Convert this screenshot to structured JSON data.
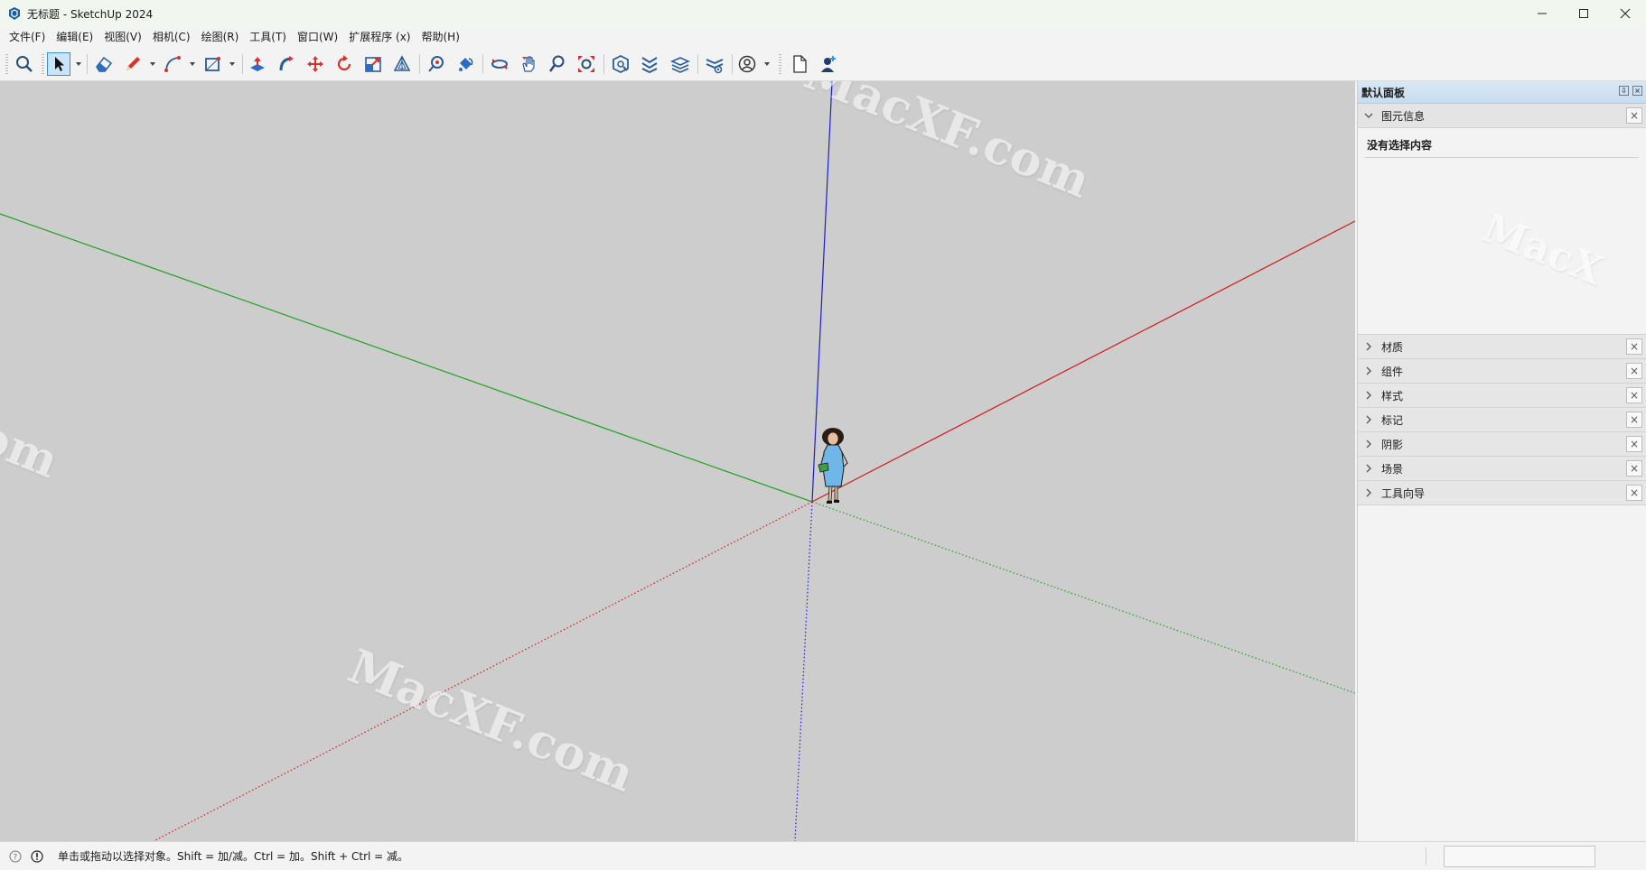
{
  "window": {
    "title": "无标题 - SketchUp 2024"
  },
  "menu": [
    "文件(F)",
    "编辑(E)",
    "视图(V)",
    "相机(C)",
    "绘图(R)",
    "工具(T)",
    "窗口(W)",
    "扩展程序 (x)",
    "帮助(H)"
  ],
  "toolbar": {
    "tools": [
      "search-icon",
      "select-icon",
      "eraser-icon",
      "pencil-icon",
      "arc-icon",
      "rectangle-icon",
      "push-pull-icon",
      "follow-me-icon",
      "move-icon",
      "rotate-icon",
      "scale-icon",
      "offset-icon",
      "tape-measure-icon",
      "paint-bucket-icon",
      "orbit-icon",
      "pan-icon",
      "zoom-icon",
      "zoom-extents-icon",
      "warehouse-icon",
      "extension-icon",
      "layers-icon",
      "sandbox-icon",
      "account-icon",
      "new-file-icon",
      "add-user-icon"
    ],
    "active_tool": "select-icon"
  },
  "axes": {
    "red": "#d11a1a",
    "green": "#1fa31f",
    "blue": "#1d1dc9"
  },
  "watermarks": [
    "MacXF.com",
    "MacXF.com",
    "MacX",
    "om"
  ],
  "tray": {
    "title": "默认面板",
    "entity_info": {
      "label": "图元信息",
      "message": "没有选择内容"
    },
    "panels": [
      "材质",
      "组件",
      "样式",
      "标记",
      "阴影",
      "场景",
      "工具向导"
    ]
  },
  "status": {
    "hint": "单击或拖动以选择对象。Shift = 加/减。Ctrl = 加。Shift + Ctrl = 减。"
  }
}
